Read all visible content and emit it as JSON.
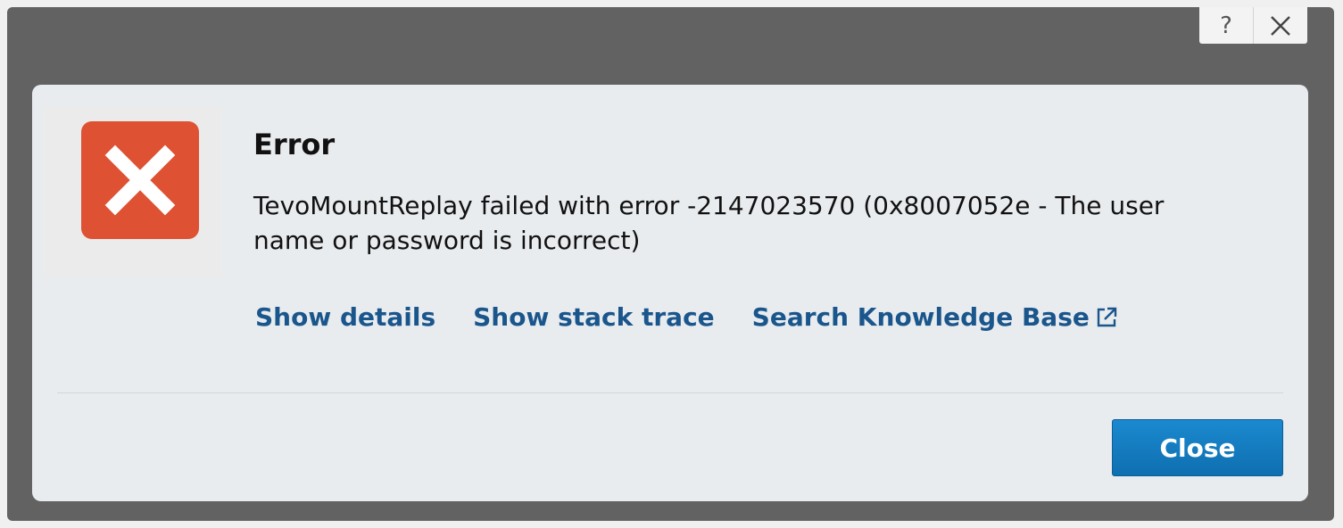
{
  "window": {
    "help_label": "?",
    "close_icon": "close-icon"
  },
  "dialog": {
    "icon": "error-x-icon",
    "title": "Error",
    "message": "TevoMountReplay failed with error -2147023570 (0x8007052e - The user name or password is incorrect)",
    "links": {
      "show_details": "Show details",
      "show_stack_trace": "Show stack trace",
      "search_kb": "Search Knowledge Base",
      "search_kb_icon": "external-link-icon"
    },
    "close_button": "Close"
  },
  "colors": {
    "frame": "#626262",
    "panel": "#e9ecef",
    "error_icon_bg": "#de5132",
    "link": "#1a568c",
    "primary_button": "#137cc1"
  }
}
